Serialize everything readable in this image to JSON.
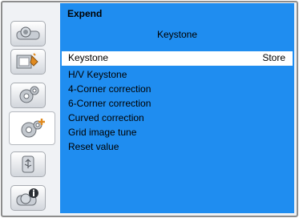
{
  "menu": {
    "title": "Expend",
    "subtitle": "Keystone",
    "selected": {
      "label": "Keystone",
      "value": "Store"
    },
    "items": [
      "H/V Keystone",
      "4-Corner correction",
      "6-Corner correction",
      "Curved correction",
      "Grid image tune",
      "Reset value"
    ]
  },
  "sidebar": {
    "icons": [
      "projector-icon",
      "image-adjust-icon",
      "gear-icon",
      "expand-gear-icon",
      "usb-icon",
      "info-icon"
    ],
    "active": "expand-gear-icon"
  },
  "colors": {
    "panel": "#1f8df0",
    "highlight": "#ffffff",
    "frame": "#8d8d8d"
  }
}
